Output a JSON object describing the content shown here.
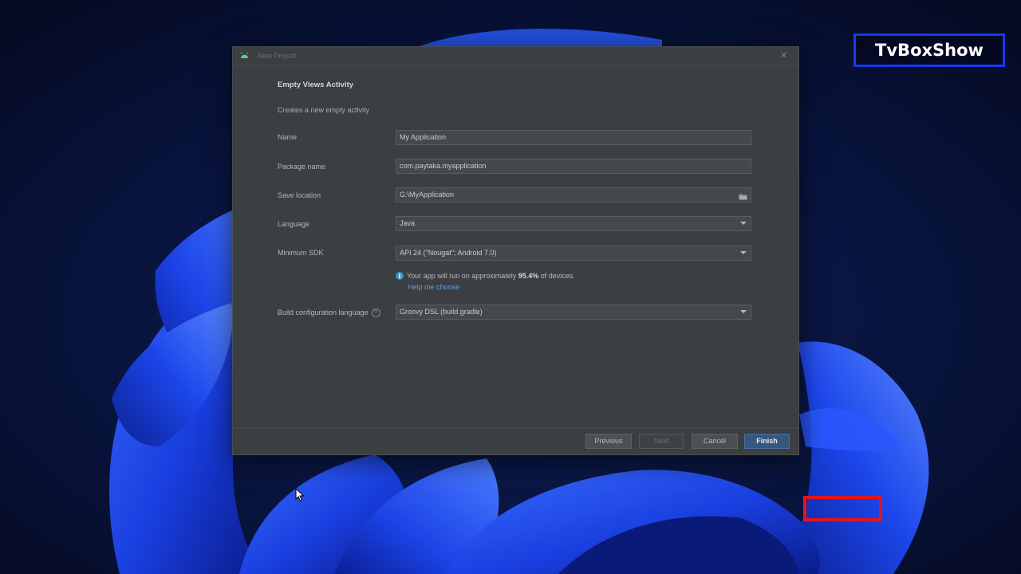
{
  "watermark": {
    "text": "TvBoxShow"
  },
  "dialog": {
    "title": "New Project",
    "heading": "Empty Views Activity",
    "description": "Creates a new empty activity",
    "fields": {
      "name": {
        "label": "Name",
        "value": "My Application"
      },
      "package": {
        "label": "Package name",
        "value": "com.paytaka.myapplication"
      },
      "location": {
        "label": "Save location",
        "value": "G:\\MyApplication",
        "icon": "folder-icon"
      },
      "language": {
        "label": "Language",
        "value": "Java"
      },
      "min_sdk": {
        "label": "Minimum SDK",
        "value": "API 24 (\"Nougat\"; Android 7.0)"
      },
      "build_lang": {
        "label": "Build configuration language",
        "value": "Groovy DSL (build.gradle)"
      }
    },
    "info": {
      "prefix": "Your app will run on approximately ",
      "percent": "95.4%",
      "suffix": " of devices.",
      "link": "Help me choose"
    },
    "buttons": {
      "previous": "Previous",
      "next": "Next",
      "cancel": "Cancel",
      "finish": "Finish"
    }
  },
  "colors": {
    "dialog_bg": "#3c3f41",
    "accent_button": "#365880",
    "link": "#589df6",
    "watermark_border": "#1a37f0",
    "highlight_box": "#e0161d"
  }
}
